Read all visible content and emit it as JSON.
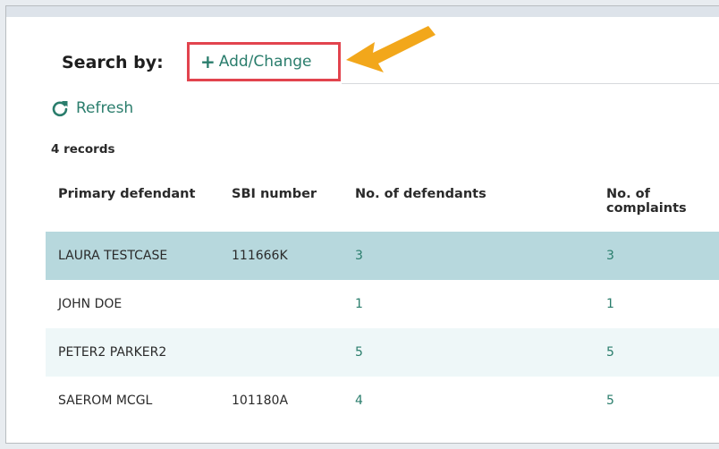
{
  "search": {
    "label": "Search by:",
    "add_change_label": "Add/Change",
    "add_change_icon": "plus-icon"
  },
  "refresh": {
    "label": "Refresh",
    "icon": "refresh-icon"
  },
  "records_count": "4 records",
  "table": {
    "headers": {
      "primary_defendant": "Primary defendant",
      "sbi_number": "SBI number",
      "no_of_defendants": "No. of defendants",
      "no_of_complaints": "No. of complaints"
    },
    "rows": [
      {
        "primary_defendant": "LAURA TESTCASE",
        "sbi_number": "111666K",
        "no_of_defendants": "3",
        "no_of_complaints": "3"
      },
      {
        "primary_defendant": "JOHN DOE",
        "sbi_number": "",
        "no_of_defendants": "1",
        "no_of_complaints": "1"
      },
      {
        "primary_defendant": "PETER2 PARKER2",
        "sbi_number": "",
        "no_of_defendants": "5",
        "no_of_complaints": "5"
      },
      {
        "primary_defendant": "SAEROM MCGL",
        "sbi_number": "101180A",
        "no_of_defendants": "4",
        "no_of_complaints": "5"
      }
    ]
  },
  "colors": {
    "accent": "#2a7d6c",
    "highlight_border": "#e2444e",
    "callout_arrow": "#f2a71b",
    "selected_row": "#b7d8dd",
    "striped_row": "#eef7f8"
  }
}
